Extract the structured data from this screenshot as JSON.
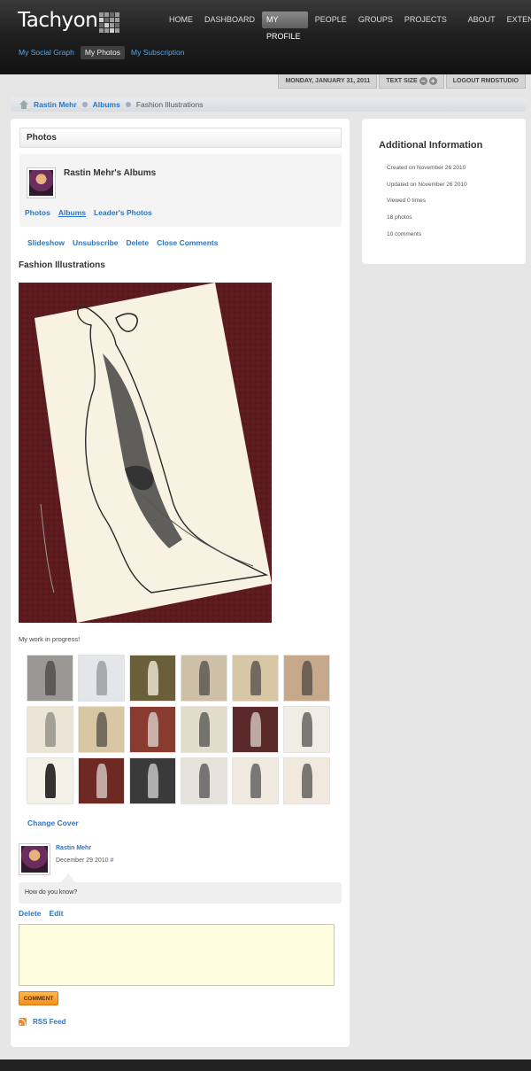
{
  "app": {
    "logo": "Tachyon"
  },
  "nav": {
    "items": [
      {
        "label": "HOME"
      },
      {
        "label": "DASHBOARD"
      },
      {
        "label": "MY PROFILE",
        "active": true
      },
      {
        "label": "PEOPLE"
      },
      {
        "label": "GROUPS"
      },
      {
        "label": "PROJECTS"
      },
      {
        "label": "ABOUT"
      },
      {
        "label": "EXTEND"
      }
    ]
  },
  "subnav": {
    "items": [
      {
        "label": "My Social Graph"
      },
      {
        "label": "My Photos",
        "active": true
      },
      {
        "label": "My Subscription"
      }
    ]
  },
  "utility": {
    "date": "MONDAY, JANUARY 31, 2011",
    "text_size": "TEXT SIZE",
    "minus": "−",
    "plus": "+",
    "logout": "LOGOUT RMDSTUDIO"
  },
  "breadcrumb": {
    "items": [
      "Rastin Mehr",
      "Albums"
    ],
    "current": "Fashion Illustrations"
  },
  "photos": {
    "heading": "Photos",
    "album_owner_title": "Rastin Mehr's Albums",
    "tabs": [
      {
        "label": "Photos"
      },
      {
        "label": "Albums",
        "active": true
      },
      {
        "label": "Leader's Photos"
      }
    ],
    "actions": [
      "Slideshow",
      "Unsubscribe",
      "Delete",
      "Close Comments"
    ],
    "album_title": "Fashion Illustrations",
    "caption": "My work in progress!",
    "change_cover": "Change Cover"
  },
  "comment": {
    "author": "Rastin Mehr",
    "date": "December 29 2010",
    "permalink": "#",
    "text": "How do you know?",
    "actions": [
      "Delete",
      "Edit"
    ],
    "input_value": "",
    "submit": "COMMENT"
  },
  "rss": {
    "label": "RSS Feed"
  },
  "sidebar": {
    "title": "Additional Information",
    "lines": [
      "Created on November 26 2010",
      "Updated on November 26 2010",
      "Viewed 0 times",
      "18 photos",
      "10 comments"
    ]
  },
  "colors": {
    "link": "#2a75c4",
    "subnav_link": "#58a6e8",
    "comment_button": "#f5901e",
    "cover_background": "#5a1a1c"
  }
}
